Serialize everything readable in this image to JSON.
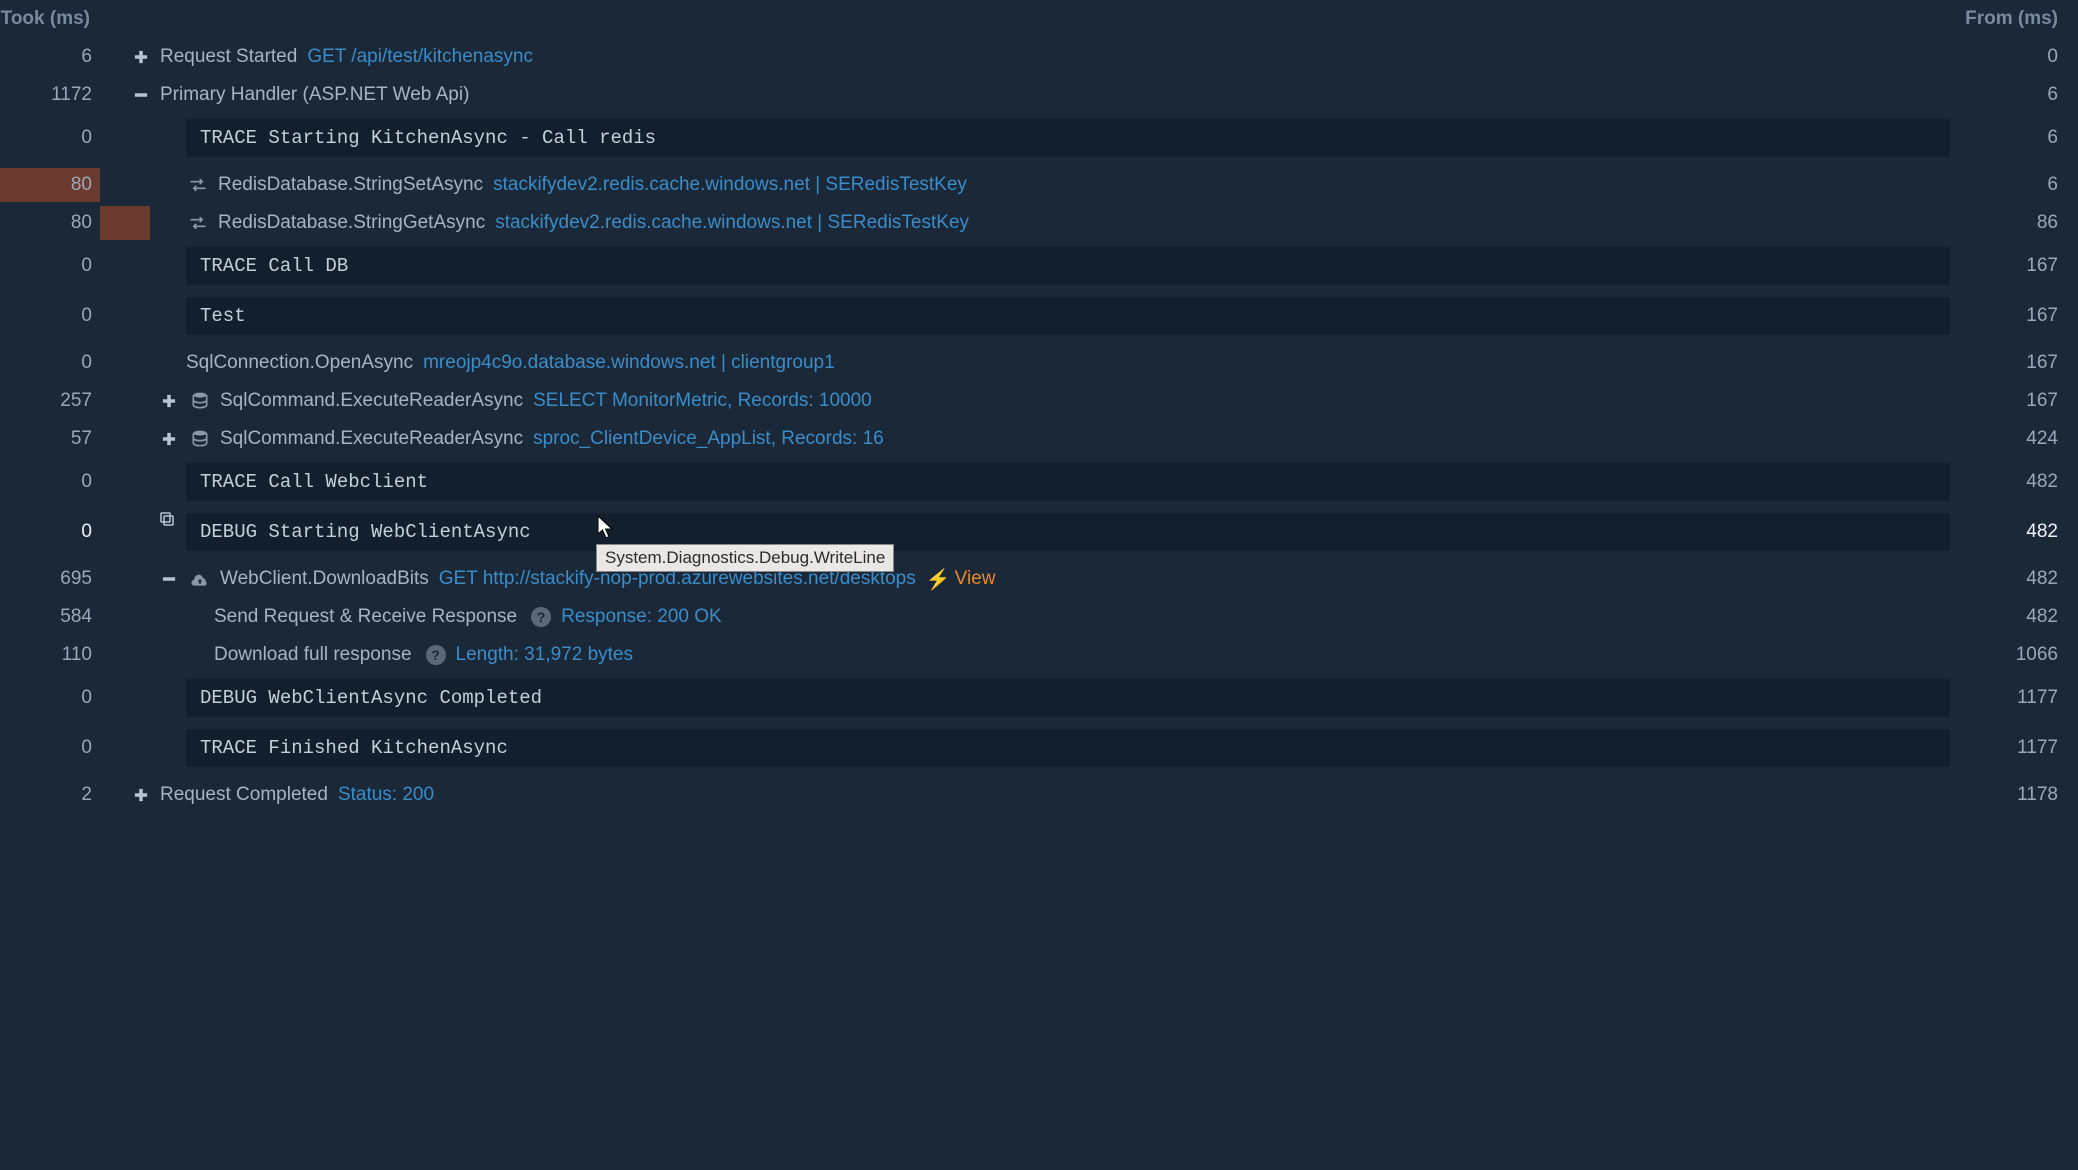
{
  "headers": {
    "took": "Took (ms)",
    "from": "From (ms)"
  },
  "tooltip": "System.Diagnostics.Debug.WriteLine",
  "rows": [
    {
      "took": "6",
      "from": "0",
      "indent": 0,
      "expander": "plus",
      "label": "Request Started",
      "link": "GET /api/test/kitchenasync"
    },
    {
      "took": "1172",
      "from": "6",
      "indent": 0,
      "expander": "minus",
      "label": "Primary Handler (ASP.NET Web Api)"
    },
    {
      "took": "0",
      "from": "6",
      "indent": 2,
      "code": "TRACE Starting KitchenAsync - Call redis"
    },
    {
      "took": "80",
      "from": "6",
      "indent": 2,
      "icon": "swap",
      "label": "RedisDatabase.StringSetAsync",
      "link": "stackifydev2.redis.cache.windows.net | SERedisTestKey",
      "bar": 100
    },
    {
      "took": "80",
      "from": "86",
      "indent": 2,
      "icon": "swap",
      "label": "RedisDatabase.StringGetAsync",
      "link": "stackifydev2.redis.cache.windows.net | SERedisTestKey",
      "bar": 50,
      "baroffset": 100
    },
    {
      "took": "0",
      "from": "167",
      "indent": 2,
      "code": "TRACE Call DB"
    },
    {
      "took": "0",
      "from": "167",
      "indent": 2,
      "code": "Test"
    },
    {
      "took": "0",
      "from": "167",
      "indent": 2,
      "label": "SqlConnection.OpenAsync",
      "link": "mreojp4c9o.database.windows.net | clientgroup1"
    },
    {
      "took": "257",
      "from": "167",
      "indent": 1,
      "expander": "plus",
      "icon": "db",
      "label": "SqlCommand.ExecuteReaderAsync",
      "link": "SELECT MonitorMetric, Records: 10000"
    },
    {
      "took": "57",
      "from": "424",
      "indent": 1,
      "expander": "plus",
      "icon": "db",
      "label": "SqlCommand.ExecuteReaderAsync",
      "link": "sproc_ClientDevice_AppList, Records: 16"
    },
    {
      "took": "0",
      "from": "482",
      "indent": 2,
      "code": "TRACE Call Webclient"
    },
    {
      "took": "0",
      "from": "482",
      "indent": 2,
      "code": "DEBUG Starting WebClientAsync",
      "clone": true,
      "highlight": true
    },
    {
      "took": "695",
      "from": "482",
      "indent": 1,
      "expander": "minus",
      "icon": "cloud",
      "label": "WebClient.DownloadBits",
      "link": "GET http://stackify-nop-prod.azurewebsites.net/desktops",
      "view": "View"
    },
    {
      "took": "584",
      "from": "482",
      "indent": 3,
      "label": "Send Request & Receive Response",
      "help": true,
      "link": "Response: 200 OK"
    },
    {
      "took": "110",
      "from": "1066",
      "indent": 3,
      "label": "Download full response",
      "help": true,
      "link": "Length: 31,972 bytes"
    },
    {
      "took": "0",
      "from": "1177",
      "indent": 2,
      "code": "DEBUG WebClientAsync Completed"
    },
    {
      "took": "0",
      "from": "1177",
      "indent": 2,
      "code": "TRACE Finished KitchenAsync"
    },
    {
      "took": "2",
      "from": "1178",
      "indent": 0,
      "expander": "plus",
      "label": "Request Completed",
      "link": "Status: 200"
    }
  ]
}
